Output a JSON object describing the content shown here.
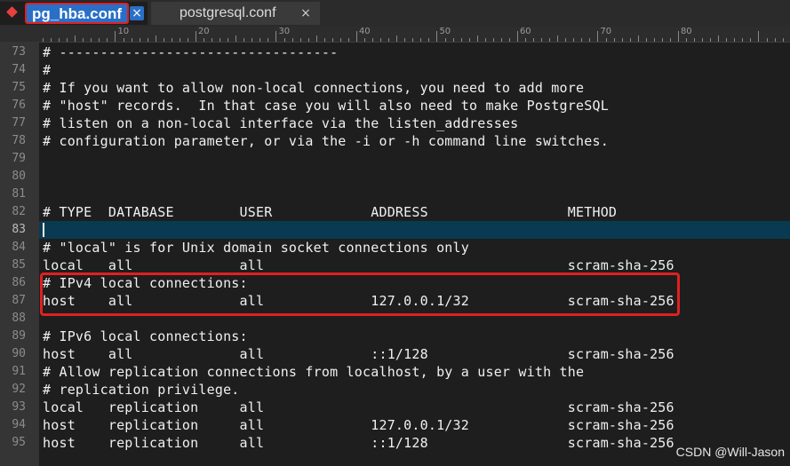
{
  "tabs": [
    {
      "label": "pg_hba.conf",
      "close": "×",
      "active": true,
      "icon": "modified-diamond-icon"
    },
    {
      "label": "postgresql.conf",
      "close": "×",
      "active": false
    }
  ],
  "ruler": {
    "labels": [
      "10",
      "20",
      "30",
      "40",
      "50",
      "60",
      "70",
      "80"
    ]
  },
  "editor": {
    "lines": [
      {
        "num": "73",
        "text": "# ----------------------------------"
      },
      {
        "num": "74",
        "text": "#"
      },
      {
        "num": "75",
        "text": "# If you want to allow non-local connections, you need to add more"
      },
      {
        "num": "76",
        "text": "# \"host\" records.  In that case you will also need to make PostgreSQL"
      },
      {
        "num": "77",
        "text": "# listen on a non-local interface via the listen_addresses"
      },
      {
        "num": "78",
        "text": "# configuration parameter, or via the -i or -h command line switches."
      },
      {
        "num": "79",
        "text": ""
      },
      {
        "num": "80",
        "text": ""
      },
      {
        "num": "81",
        "text": ""
      },
      {
        "num": "82",
        "text": "# TYPE  DATABASE        USER            ADDRESS                 METHOD"
      },
      {
        "num": "83",
        "text": ""
      },
      {
        "num": "84",
        "text": "# \"local\" is for Unix domain socket connections only"
      },
      {
        "num": "85",
        "text": "local   all             all                                     scram-sha-256"
      },
      {
        "num": "86",
        "text": "# IPv4 local connections:"
      },
      {
        "num": "87",
        "text": "host    all             all             127.0.0.1/32            scram-sha-256"
      },
      {
        "num": "88",
        "text": ""
      },
      {
        "num": "89",
        "text": "# IPv6 local connections:"
      },
      {
        "num": "90",
        "text": "host    all             all             ::1/128                 scram-sha-256"
      },
      {
        "num": "91",
        "text": "# Allow replication connections from localhost, by a user with the"
      },
      {
        "num": "92",
        "text": "# replication privilege."
      },
      {
        "num": "93",
        "text": "local   replication     all                                     scram-sha-256"
      },
      {
        "num": "94",
        "text": "host    replication     all             127.0.0.1/32            scram-sha-256"
      },
      {
        "num": "95",
        "text": "host    replication     all             ::1/128                 scram-sha-256"
      }
    ],
    "current_line": "83"
  },
  "watermark": "CSDN @Will-Jason",
  "colors": {
    "background": "#1e1e1e",
    "active_tab": "#2a6fc7",
    "highlight_box": "#e02020",
    "current_line": "#083b52"
  }
}
